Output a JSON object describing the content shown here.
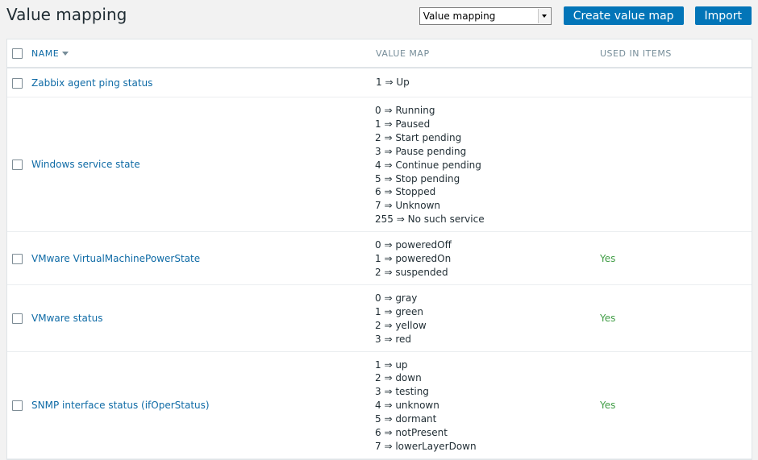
{
  "page": {
    "title": "Value mapping"
  },
  "header": {
    "select_value": "Value mapping",
    "create_button": "Create value map",
    "import_button": "Import"
  },
  "table": {
    "columns": {
      "name": "NAME",
      "value_map": "VALUE MAP",
      "used_in_items": "USED IN ITEMS"
    },
    "rows": [
      {
        "name": "Zabbix agent ping status",
        "maps": [
          "1 ⇒ Up"
        ],
        "used": ""
      },
      {
        "name": "Windows service state",
        "maps": [
          "0 ⇒ Running",
          "1 ⇒ Paused",
          "2 ⇒ Start pending",
          "3 ⇒ Pause pending",
          "4 ⇒ Continue pending",
          "5 ⇒ Stop pending",
          "6 ⇒ Stopped",
          "7 ⇒ Unknown",
          "255 ⇒ No such service"
        ],
        "used": ""
      },
      {
        "name": "VMware VirtualMachinePowerState",
        "maps": [
          "0 ⇒ poweredOff",
          "1 ⇒ poweredOn",
          "2 ⇒ suspended"
        ],
        "used": "Yes"
      },
      {
        "name": "VMware status",
        "maps": [
          "0 ⇒ gray",
          "1 ⇒ green",
          "2 ⇒ yellow",
          "3 ⇒ red"
        ],
        "used": "Yes"
      },
      {
        "name": "SNMP interface status (ifOperStatus)",
        "maps": [
          "1 ⇒ up",
          "2 ⇒ down",
          "3 ⇒ testing",
          "4 ⇒ unknown",
          "5 ⇒ dormant",
          "6 ⇒ notPresent",
          "7 ⇒ lowerLayerDown"
        ],
        "used": "Yes"
      }
    ]
  },
  "colors": {
    "accent": "#0275b8",
    "link": "#0f6ba6",
    "used_yes": "#429e47"
  }
}
